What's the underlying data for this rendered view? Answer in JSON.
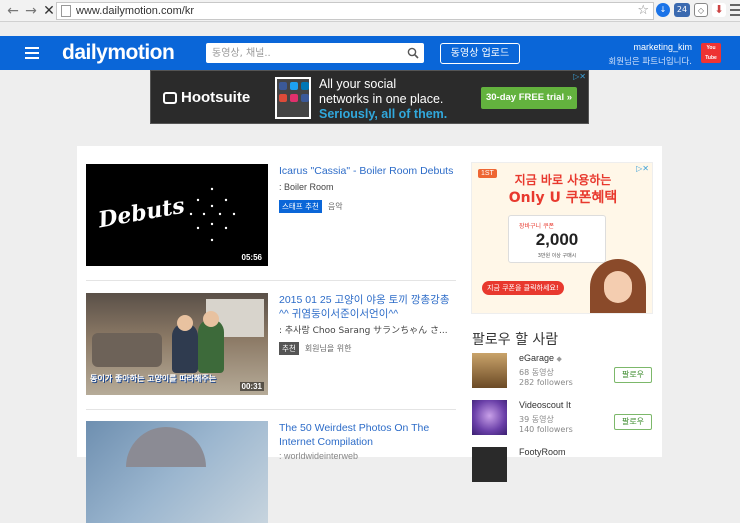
{
  "browser": {
    "url": "www.dailymotion.com/kr",
    "back_icon": "←",
    "forward_icon": "→",
    "stop_icon": "✕",
    "star_icon": "☆"
  },
  "header": {
    "logo": "dailymotion",
    "search_placeholder": "동영상, 채널..",
    "upload_label": "동영상 업로드",
    "username": "marketing_kim",
    "user_sub": "회원님은 파트너입니다.",
    "brand_color": "#0a66d8"
  },
  "banner_ad": {
    "brand": "Hootsuite",
    "line1": "All your social",
    "line2": "networks in one place.",
    "line3": "Seriously, all of them.",
    "cta": "30-day FREE trial »",
    "close": "▷✕"
  },
  "videos": [
    {
      "title": "Icarus \"Cassia\" - Boiler Room Debuts",
      "channel": ": Boiler Room",
      "tag": "스태프 추천",
      "tag_text": "음악",
      "duration": "05:56",
      "thumb_text": "Debuts"
    },
    {
      "title": "2015 01 25 고양이 야옹 토끼 깡총강총^^ 귀염둥이서준이서언이^^",
      "channel": ": 추사랑 Choo Sarang サランちゃん さ...",
      "tag": "추천",
      "tag_text": "회원님을 위한",
      "duration": "00:31",
      "thumb_caption": "동이가 좋아하는 고양이를 따라해주는"
    },
    {
      "title": "The 50 Weirdest Photos On The Internet Compilation",
      "channel": ": worldwideinterweb"
    }
  ],
  "side_ad": {
    "badge": "1ST",
    "headline1": "지금 바로 사용하는",
    "headline2": "Only U 쿠폰혜택",
    "coupon_top": "장바구니 쿠폰",
    "coupon_value": "2,000",
    "coupon_sub": "3만원 이상 구매시",
    "cta": "지금 쿠폰을 클릭하세요!",
    "close": "▷✕"
  },
  "follow": {
    "title": "팔로우 할 사람",
    "button_label": "팔로우",
    "users": [
      {
        "name": "eGarage",
        "verified": "◆",
        "videos": "68 동영상",
        "followers": "282 followers"
      },
      {
        "name": "Videoscout It",
        "videos": "39 동영상",
        "followers": "140 followers"
      },
      {
        "name": "FootyRoom"
      }
    ]
  }
}
